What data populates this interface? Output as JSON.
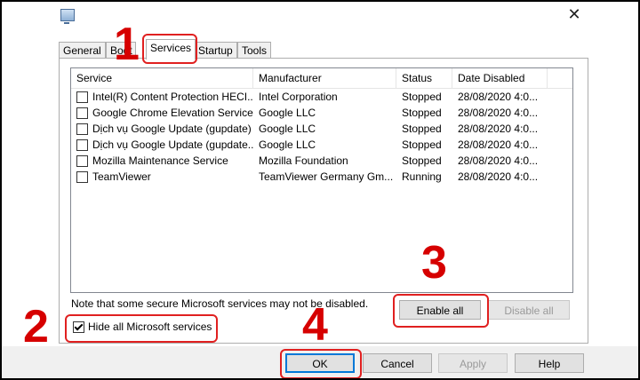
{
  "window": {
    "close_symbol": "✕"
  },
  "tabs": [
    {
      "label": "General",
      "active": false
    },
    {
      "label": "Boot",
      "active": false
    },
    {
      "label": "Services",
      "active": true
    },
    {
      "label": "Startup",
      "active": false
    },
    {
      "label": "Tools",
      "active": false
    }
  ],
  "services_table": {
    "headers": [
      "Service",
      "Manufacturer",
      "Status",
      "Date Disabled"
    ],
    "rows": [
      {
        "checked": false,
        "service": "Intel(R) Content Protection HECI...",
        "manufacturer": "Intel Corporation",
        "status": "Stopped",
        "date_disabled": "28/08/2020 4:0..."
      },
      {
        "checked": false,
        "service": "Google Chrome Elevation Service",
        "manufacturer": "Google LLC",
        "status": "Stopped",
        "date_disabled": "28/08/2020 4:0..."
      },
      {
        "checked": false,
        "service": "Dịch vụ Google Update (gupdate)",
        "manufacturer": "Google LLC",
        "status": "Stopped",
        "date_disabled": "28/08/2020 4:0..."
      },
      {
        "checked": false,
        "service": "Dịch vụ Google Update (gupdate...",
        "manufacturer": "Google LLC",
        "status": "Stopped",
        "date_disabled": "28/08/2020 4:0..."
      },
      {
        "checked": false,
        "service": "Mozilla Maintenance Service",
        "manufacturer": "Mozilla Foundation",
        "status": "Stopped",
        "date_disabled": "28/08/2020 4:0..."
      },
      {
        "checked": false,
        "service": "TeamViewer",
        "manufacturer": "TeamViewer Germany Gm...",
        "status": "Running",
        "date_disabled": "28/08/2020 4:0..."
      }
    ]
  },
  "note": "Note that some secure Microsoft services may not be disabled.",
  "hide_microsoft": {
    "label": "Hide all Microsoft services",
    "checked": true
  },
  "buttons": {
    "enable_all": "Enable all",
    "disable_all": "Disable all",
    "ok": "OK",
    "cancel": "Cancel",
    "apply": "Apply",
    "help": "Help"
  },
  "annotations": {
    "step1": "1",
    "step2": "2",
    "step3": "3",
    "step4": "4",
    "color": "#e02020"
  }
}
